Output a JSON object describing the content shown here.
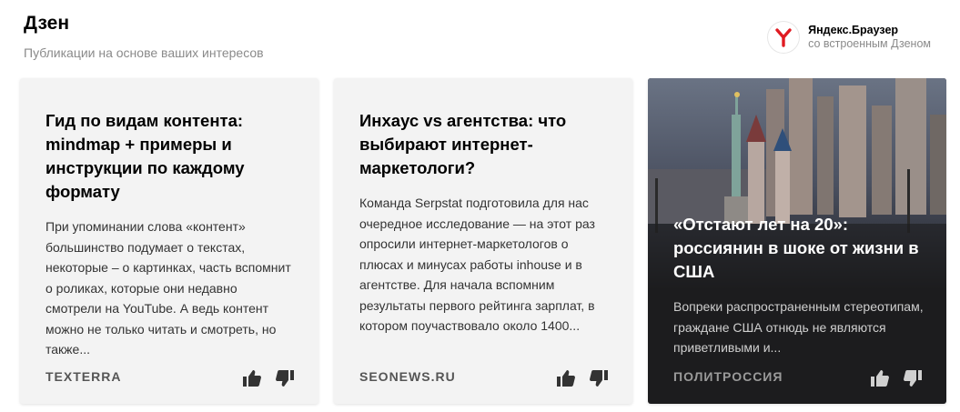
{
  "header": {
    "title": "Дзен",
    "subtitle": "Публикации на основе ваших интересов"
  },
  "promo": {
    "logo_icon": "yandex-browser-logo-icon",
    "name": "Яндекс.Браузер",
    "desc": "со встроенным Дзеном",
    "accent": "#e01b22"
  },
  "cards": [
    {
      "title": "Гид по видам контента: mindmap + примеры и инструкции по каждому формату",
      "text": "При упоминании слова «контент» большинство подумает о текстах, некоторые – о картинках, часть вспомнит о роликах, которые они недавно смотрели на YouTube. А ведь контент можно не только читать и смотреть, но также...",
      "source": "TEXTERRA"
    },
    {
      "title": "Инхаус vs агентства: что выбирают интернет-маркетологи?",
      "text": "Команда Serpstat подготовила для нас очередное исследование — на этот раз опросили интернет-маркетологов о плюсах и минусах работы inhouse и в агентстве. Для начала вспомним результаты первого рейтинга зарплат, в котором поучаствовало около 1400...",
      "source": "SEONEWS.RU"
    },
    {
      "title": "«Отстают лет на 20»: россиянин в шоке от жизни в США",
      "text": "Вопреки распространенным стереотипам, граждане США отнюдь не являются приветливыми и...",
      "source": "ПОЛИТРОССИЯ"
    }
  ],
  "icons": {
    "like": "thumbs-up-icon",
    "dislike": "thumbs-down-icon"
  }
}
